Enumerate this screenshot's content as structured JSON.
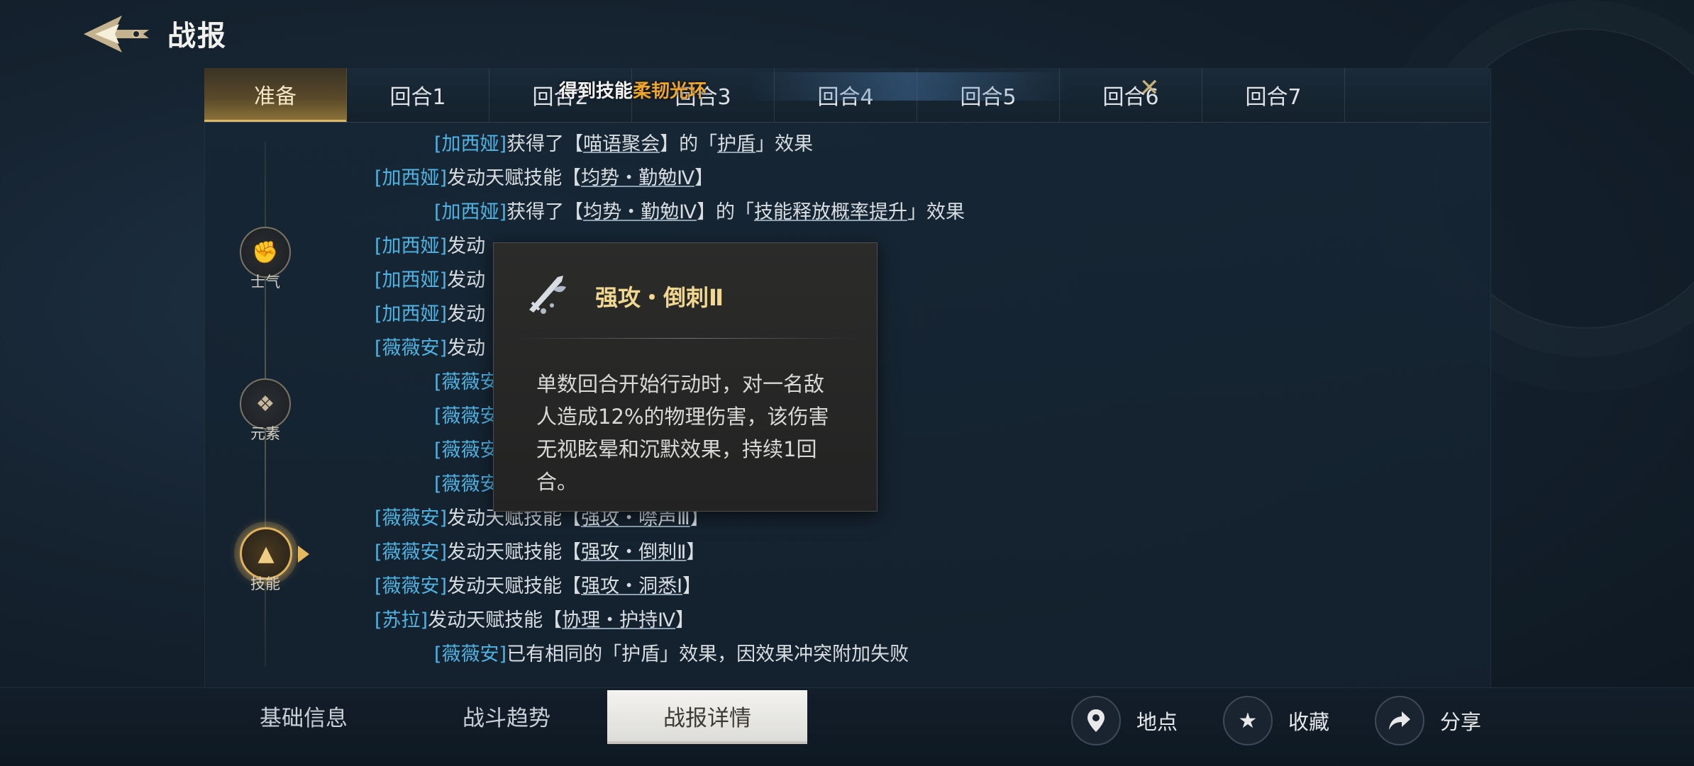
{
  "header": {
    "title": "战报"
  },
  "rounds": {
    "tabs": [
      "准备",
      "回合1",
      "回合2",
      "回合3",
      "回合4",
      "回合5",
      "回合6",
      "回合7"
    ],
    "active_index": 0
  },
  "toast": {
    "prefix": "得到技能",
    "highlight": "柔韧光环"
  },
  "timeline": {
    "nodes": [
      {
        "label": "士气",
        "icon": "fist-icon"
      },
      {
        "label": "元素",
        "icon": "element-icon"
      },
      {
        "label": "技能",
        "icon": "skill-icon"
      }
    ],
    "active": "技能"
  },
  "log": [
    {
      "who": "[加西娅]",
      "t1": "获得了【",
      "skill": "喵语聚会",
      "t2": "】的「",
      "skill2": "护盾",
      "t3": "」效果"
    },
    {
      "who": "[加西娅]",
      "t1": "发动天赋技能【",
      "skill": "均势・勤勉Ⅳ",
      "t2": "】"
    },
    {
      "who": "[加西娅]",
      "t1": "获得了【",
      "skill": "均势・勤勉Ⅳ",
      "t2": "】的「",
      "skill2": "技能释放概率提升",
      "t3": "」效果"
    },
    {
      "who": "[加西娅]",
      "t1": "发动"
    },
    {
      "who": "[加西娅]",
      "t1": "发动"
    },
    {
      "who": "[加西娅]",
      "t1": "发动"
    },
    {
      "who": "[薇薇安]",
      "t1": "发动"
    },
    {
      "who": "[薇薇安"
    },
    {
      "who": "[薇薇安"
    },
    {
      "who": "[薇薇安"
    },
    {
      "who": "[薇薇安"
    },
    {
      "who": "[薇薇安]",
      "t1": "发动天赋技能【",
      "skill": "强攻・噤声Ⅲ",
      "t2": "】"
    },
    {
      "who": "[薇薇安]",
      "t1": "发动天赋技能【",
      "skill": "强攻・倒刺Ⅱ",
      "t2": "】"
    },
    {
      "who": "[薇薇安]",
      "t1": "发动天赋技能【",
      "skill": "强攻・洞悉Ⅰ",
      "t2": "】"
    },
    {
      "who": "[苏拉]",
      "t1": "发动天赋技能【",
      "skill": "协理・护持Ⅳ",
      "t2": "】"
    },
    {
      "who": "[薇薇安]",
      "t1": "已有相同的「护盾」效果，因效果冲突附加失败"
    }
  ],
  "tooltip": {
    "icon": "sword-drops-icon",
    "title": "强攻・倒刺Ⅱ",
    "description": "单数回合开始行动时，对一名敌人造成12%的物理伤害，该伤害无视眩晕和沉默效果，持续1回合。"
  },
  "bottom_tabs": [
    "基础信息",
    "战斗趋势",
    "战报详情"
  ],
  "bottom_active": "战报详情",
  "actions": [
    {
      "label": "地点",
      "icon": "location-pin-icon"
    },
    {
      "label": "收藏",
      "icon": "star-icon"
    },
    {
      "label": "分享",
      "icon": "share-arrow-icon"
    }
  ],
  "colors": {
    "accent_gold": "#d8b86a",
    "name_blue": "#4fb4e3",
    "skill_gold": "#f1d78f",
    "toast_orange": "#f0a52a"
  }
}
